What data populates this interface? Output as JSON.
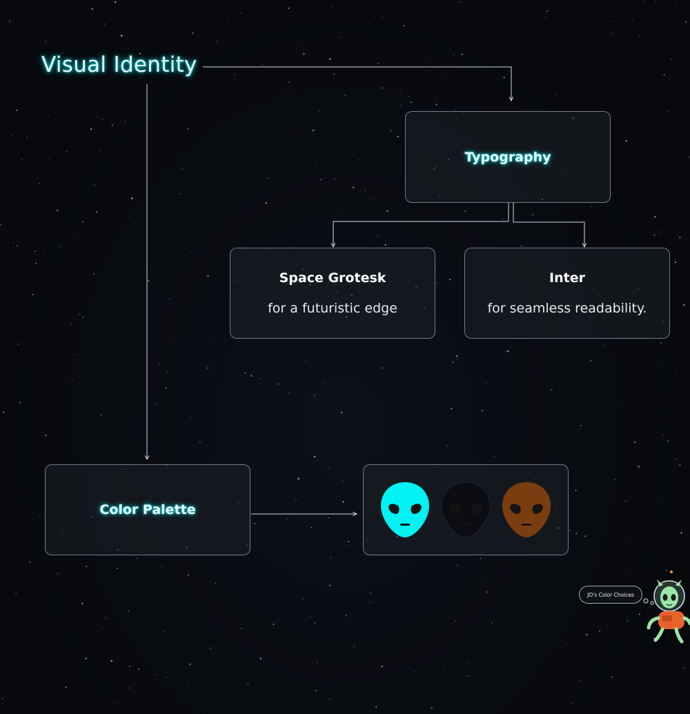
{
  "diagram": {
    "title": "Visual Identity",
    "typography": {
      "label": "Typography",
      "fonts": [
        {
          "name": "Space Grotesk",
          "description": "for a futuristic edge"
        },
        {
          "name": "Inter",
          "description": "for seamless readability."
        }
      ]
    },
    "color_palette": {
      "label": "Color Palette",
      "swatches": [
        {
          "icon": "alien-head-icon",
          "color": "#00f2f2"
        },
        {
          "icon": "alien-head-icon",
          "color": "#0c0d12"
        },
        {
          "icon": "alien-head-icon",
          "color": "#7a3d10"
        }
      ]
    }
  },
  "mascot": {
    "bubble_text": "JO's Color Choices",
    "icon": "astronaut-alien-mascot-icon"
  },
  "theme": {
    "background": "#07090d",
    "glow": "#00e5f0",
    "border": "#c8d2dc"
  }
}
